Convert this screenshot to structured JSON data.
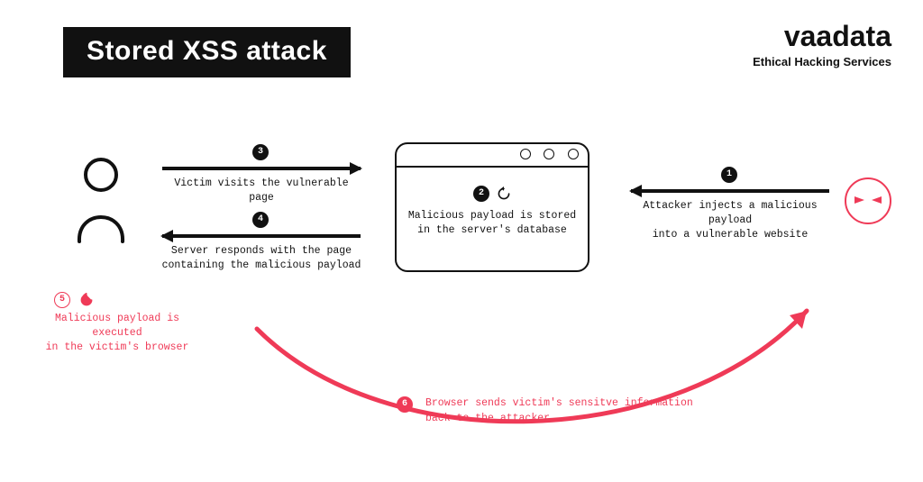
{
  "header": {
    "title": "Stored XSS attack",
    "logo_brand": "vaadata",
    "logo_tagline": "Ethical Hacking Services"
  },
  "steps": {
    "s1": {
      "num": "1",
      "text": "Attacker injects a malicious payload into a vulnerable website"
    },
    "s2": {
      "num": "2",
      "text": "Malicious payload is stored in the server's database"
    },
    "s3": {
      "num": "3",
      "text": "Victim visits the vulnerable page"
    },
    "s4": {
      "num": "4",
      "text": "Server responds with the page containing the malicious payload"
    },
    "s5": {
      "num": "5",
      "text": "Malicious payload is executed in the victim's browser"
    },
    "s6": {
      "num": "6",
      "text": "Browser sends victim's sensitve information back to the attacker"
    }
  },
  "colors": {
    "accent": "#ef3a57",
    "ink": "#111111"
  }
}
